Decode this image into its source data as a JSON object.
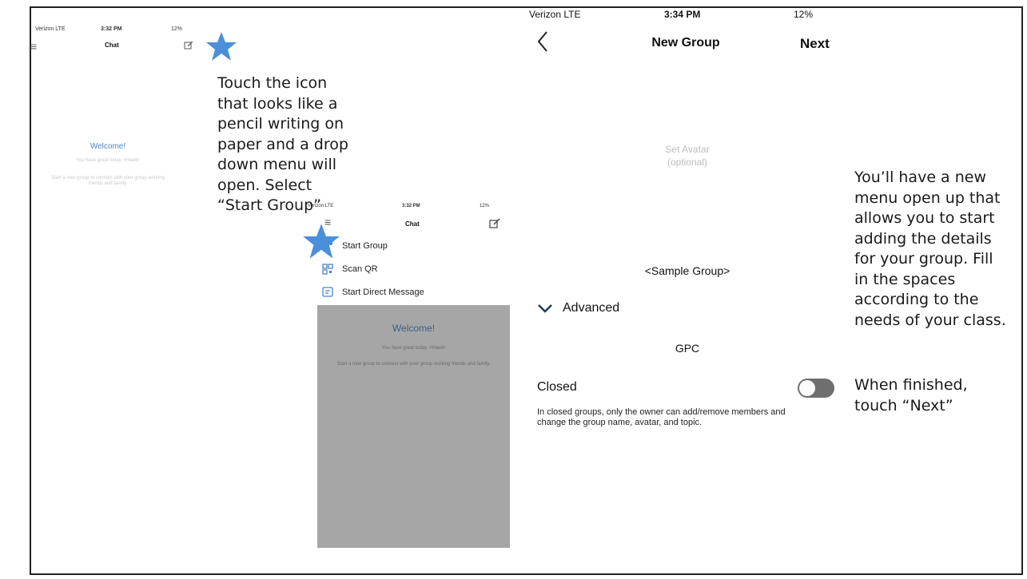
{
  "left_screen": {
    "status": {
      "carrier": "Verizon LTE",
      "time": "3:32 PM",
      "battery": "12%"
    },
    "title": "Chat",
    "welcome_title": "Welcome!",
    "welcome_sub": "You have great today. #Hawk!",
    "welcome_body": "Start a new group to connect with your group working friends and family."
  },
  "callout_1": {
    "lines": [
      "Touch the icon",
      "that looks like a",
      "pencil writing on",
      "paper and a drop",
      "down menu will",
      "open. Select",
      "“Start Group”"
    ]
  },
  "dropdown_screen": {
    "status": {
      "carrier": "Verizon LTE",
      "time": "3:32 PM",
      "battery": "12%"
    },
    "title": "Chat",
    "menu": [
      {
        "label": "Start Group",
        "icon": "group-icon"
      },
      {
        "label": "Scan QR",
        "icon": "qr-icon"
      },
      {
        "label": "Start Direct Message",
        "icon": "message-icon"
      }
    ],
    "welcome_title": "Welcome!",
    "welcome_sub": "You have great today. #Hawk!",
    "welcome_body": "Start a new group to connect with your group working friends and family."
  },
  "new_group_screen": {
    "status": {
      "carrier": "Verizon LTE",
      "time": "3:34 PM",
      "battery": "12%"
    },
    "title": "New Group",
    "next_label": "Next",
    "avatar_line1": "Set Avatar",
    "avatar_line2": "(optional)",
    "group_name": "<Sample Group>",
    "advanced_label": "Advanced",
    "topic": "GPC",
    "closed_label": "Closed",
    "closed_desc": "In closed groups, only the owner can add/remove members and change the group name, avatar, and topic."
  },
  "callout_2": {
    "lines": [
      "You’ll have a new",
      "menu open up that",
      "allows you to start",
      "adding the details",
      "for your group. Fill",
      "in the spaces",
      "according to the",
      "needs of your class."
    ],
    "finish_lines": [
      "When finished,",
      "touch “Next”"
    ]
  },
  "colors": {
    "star": "#4a8fd9",
    "accent": "#4a84c8",
    "toggle": "#6f6f6f"
  }
}
